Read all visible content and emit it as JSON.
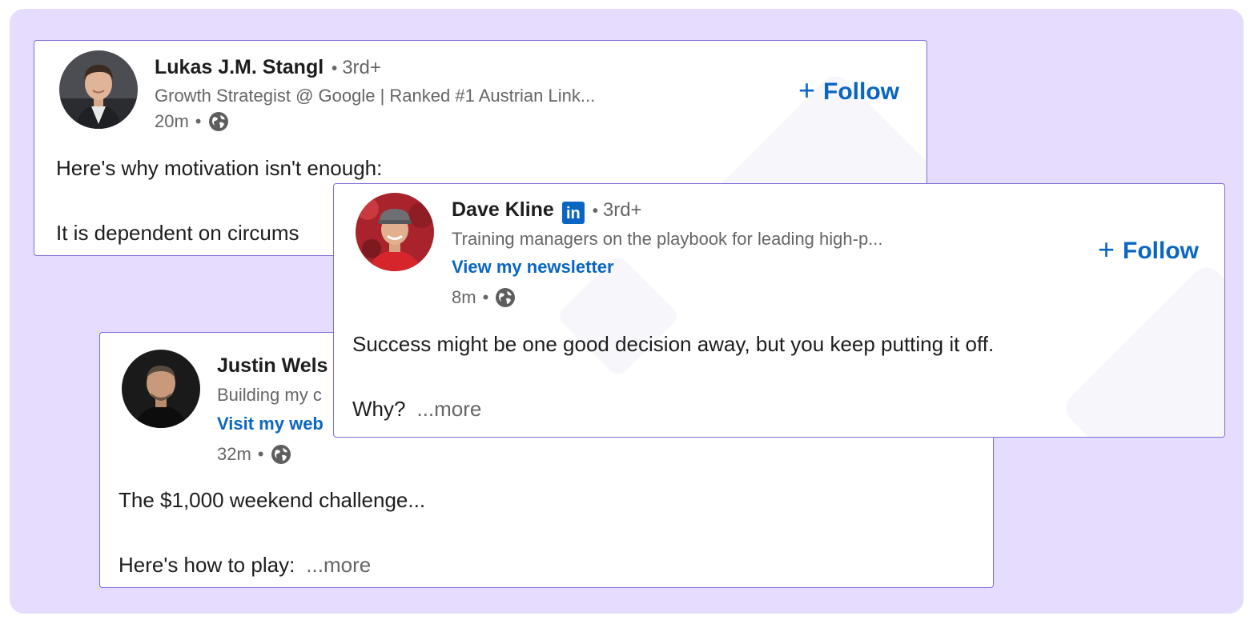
{
  "cards": {
    "lukas": {
      "name": "Lukas J.M. Stangl",
      "degree": "3rd+",
      "headline": "Growth Strategist @ Google | Ranked #1 Austrian Link...",
      "time": "20m",
      "follow_label": "Follow",
      "post_line1": "Here's why motivation isn't enough:",
      "post_line2": "It is dependent on circums",
      "avatar_icon": "profile-photo-icon"
    },
    "dave": {
      "name": "Dave Kline",
      "badge": "in",
      "degree": "3rd+",
      "headline": "Training managers on the playbook for leading high-p...",
      "link": "View my newsletter",
      "time": "8m",
      "follow_label": "Follow",
      "post_line1": "Success might be one good decision away, but you keep putting it off.",
      "post_line2": "Why?",
      "more_label": "...more",
      "avatar_icon": "profile-photo-icon"
    },
    "justin": {
      "name": "Justin Wels",
      "headline": "Building my c",
      "link": "Visit my web",
      "time": "32m",
      "post_line1": "The $1,000 weekend challenge...",
      "post_line2": "Here's how to play:",
      "more_label": "...more",
      "avatar_icon": "profile-photo-icon"
    }
  },
  "colors": {
    "background": "#e6dcfd",
    "card_border": "#7b6fd8",
    "link_blue": "#0a66c2",
    "text_dark": "#1d1d1d",
    "text_muted": "#666666"
  }
}
